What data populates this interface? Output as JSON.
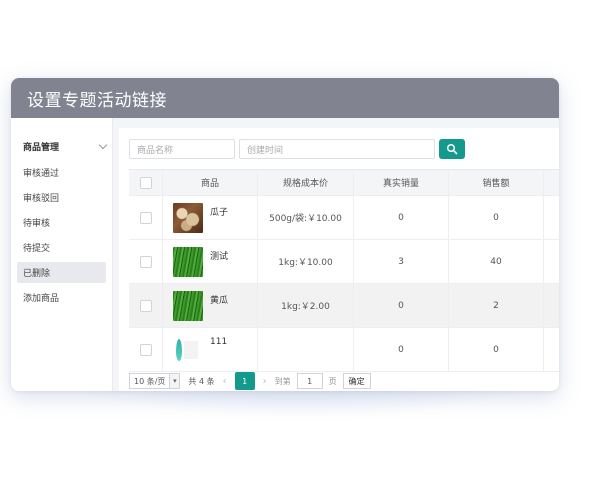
{
  "window": {
    "title": "设置专题活动链接"
  },
  "sidebar": {
    "group_label": "商品管理",
    "items": [
      {
        "label": "审核通过"
      },
      {
        "label": "审核驳回"
      },
      {
        "label": "待审核"
      },
      {
        "label": "待提交"
      },
      {
        "label": "已删除",
        "active": true
      },
      {
        "label": "添加商品"
      }
    ]
  },
  "search": {
    "name_placeholder": "商品名称",
    "time_placeholder": "创建时间",
    "button_icon": "search-icon",
    "accent": "#149a8c"
  },
  "table": {
    "headers": [
      "商品",
      "规格成本价",
      "真实销量",
      "销售额"
    ],
    "rows": [
      {
        "name": "瓜子",
        "spec": "500g/袋:￥10.00",
        "sales": "0",
        "revenue": "0",
        "thumb": "seeds"
      },
      {
        "name": "测试",
        "spec": "1kg:￥10.00",
        "sales": "3",
        "revenue": "40",
        "thumb": "grass"
      },
      {
        "name": "黄瓜",
        "spec": "1kg:￥2.00",
        "sales": "0",
        "revenue": "2",
        "thumb": "grass",
        "highlight": true
      },
      {
        "name": "111",
        "spec": "",
        "sales": "0",
        "revenue": "0",
        "thumb": "leaf"
      }
    ]
  },
  "pager": {
    "page_size": "10 条/页",
    "total": "共 4 条",
    "current_page": "1",
    "goto_label": "到第",
    "goto_value": "1",
    "page_unit": "页",
    "confirm": "确定"
  }
}
